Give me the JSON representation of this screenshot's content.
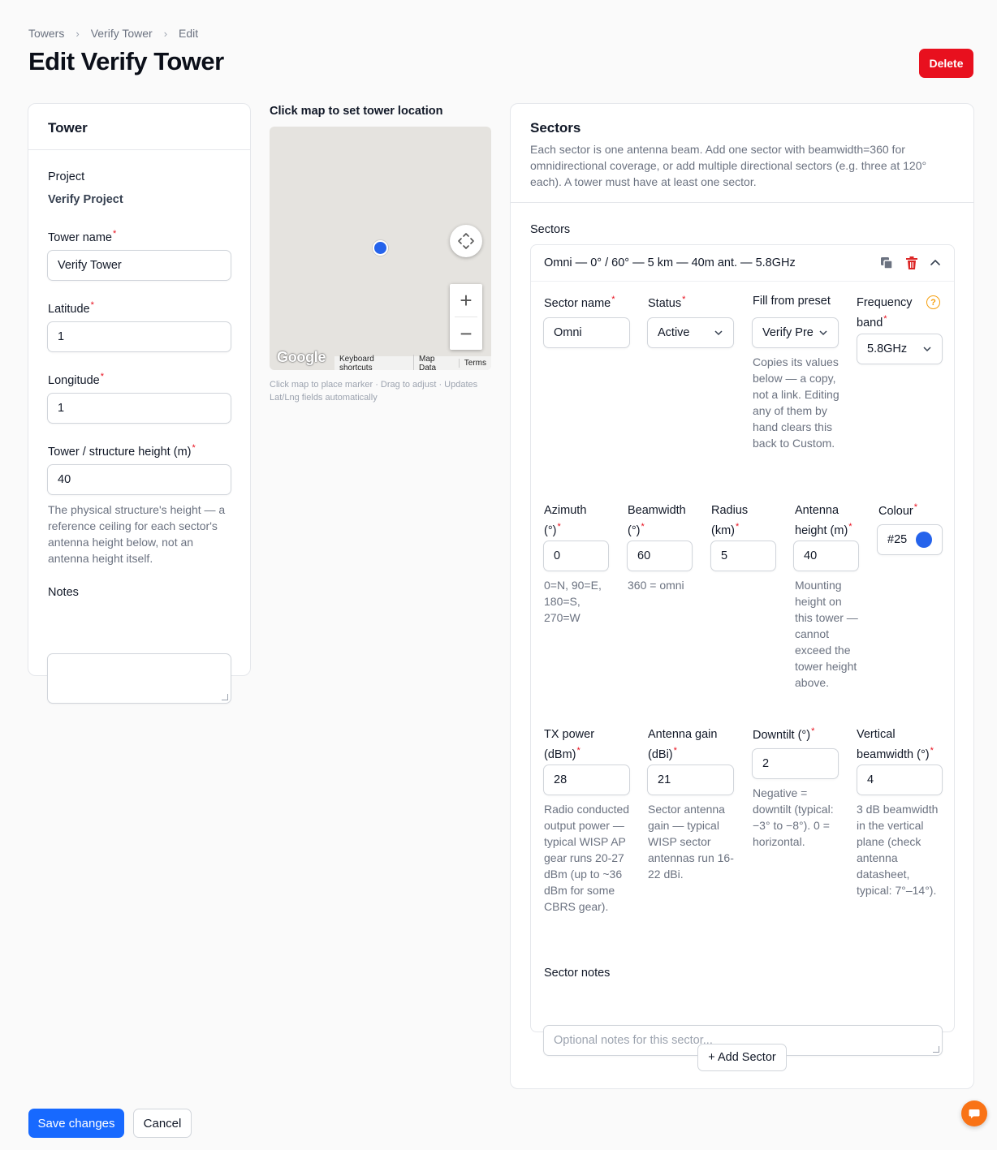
{
  "breadcrumb": {
    "items": [
      "Towers",
      "Verify Tower",
      "Edit"
    ],
    "sep": ">"
  },
  "page": {
    "title": "Edit Verify Tower",
    "delete_label": "Delete"
  },
  "tower": {
    "heading": "Tower",
    "project_label": "Project",
    "project_value": "Verify Project",
    "name_label": "Tower name",
    "name_value": "Verify Tower",
    "lat_label": "Latitude",
    "lat_value": "1",
    "lng_label": "Longitude",
    "lng_value": "1",
    "height_label": "Tower / structure height (m)",
    "height_value": "40",
    "height_help": "The physical structure's height — a reference ceiling for each sector's antenna height below, not an antenna height itself.",
    "notes_label": "Notes",
    "notes_value": "",
    "required_mark": "*"
  },
  "map": {
    "label": "Click map to set tower location",
    "logo": "Google",
    "footer": [
      "Keyboard shortcuts",
      "Map Data",
      "Terms"
    ],
    "help": "Click map to place marker · Drag to adjust · Updates Lat/Lng fields automatically",
    "marker_color": "#2563eb"
  },
  "sectors": {
    "heading": "Sectors",
    "description": "Each sector is one antenna beam. Add one sector with beamwidth=360 for omnidirectional coverage, or add multiple directional sectors (e.g. three at 120° each). A tower must have at least one sector.",
    "list_label": "Sectors",
    "summary": "Omni — 0° / 60° — 5 km — 40m ant. — 5.8GHz",
    "fields": {
      "sector_name_label": "Sector name",
      "sector_name_value": "Omni",
      "status_label": "Status",
      "status_value": "Active",
      "preset_label": "Fill from preset",
      "preset_value": "Verify Pre",
      "preset_help": "Copies its values below — a copy, not a link. Editing any of them by hand clears this back to Custom.",
      "freq_label": "Frequency band",
      "freq_value": "5.8GHz",
      "help_icon": "?",
      "azimuth_label": "Azimuth (°)",
      "azimuth_value": "0",
      "azimuth_help": "0=N, 90=E, 180=S, 270=W",
      "beamwidth_label": "Beamwidth (°)",
      "beamwidth_value": "60",
      "beamwidth_help": "360 = omni",
      "radius_label": "Radius (km)",
      "radius_value": "5",
      "ant_height_label": "Antenna height (m)",
      "ant_height_value": "40",
      "ant_height_help": "Mounting height on this tower — cannot exceed the tower height above.",
      "colour_label": "Colour",
      "colour_value": "#25",
      "colour_swatch": "#2563eb",
      "tx_label": "TX power (dBm)",
      "tx_value": "28",
      "tx_help": "Radio conducted output power — typical WISP AP gear runs 20-27 dBm (up to ~36 dBm for some CBRS gear).",
      "gain_label": "Antenna gain (dBi)",
      "gain_value": "21",
      "gain_help": "Sector antenna gain — typical WISP sector antennas run 16-22 dBi.",
      "downtilt_label": "Downtilt (°)",
      "downtilt_value": "2",
      "downtilt_help": "Negative = downtilt (typical: −3° to −8°). 0 = horizontal.",
      "vbeam_label": "Vertical beamwidth (°)",
      "vbeam_value": "4",
      "vbeam_help": "3 dB beamwidth in the vertical plane (check antenna datasheet, typical: 7°–14°).",
      "notes_label": "Sector notes",
      "notes_placeholder": "Optional notes for this sector..."
    },
    "add_label": "+ Add Sector"
  },
  "footer": {
    "save_label": "Save changes",
    "cancel_label": "Cancel"
  },
  "colors": {
    "primary": "#1769ff",
    "danger": "#e8101e",
    "chat": "#f97316",
    "help_icon": "#f59e0b"
  }
}
